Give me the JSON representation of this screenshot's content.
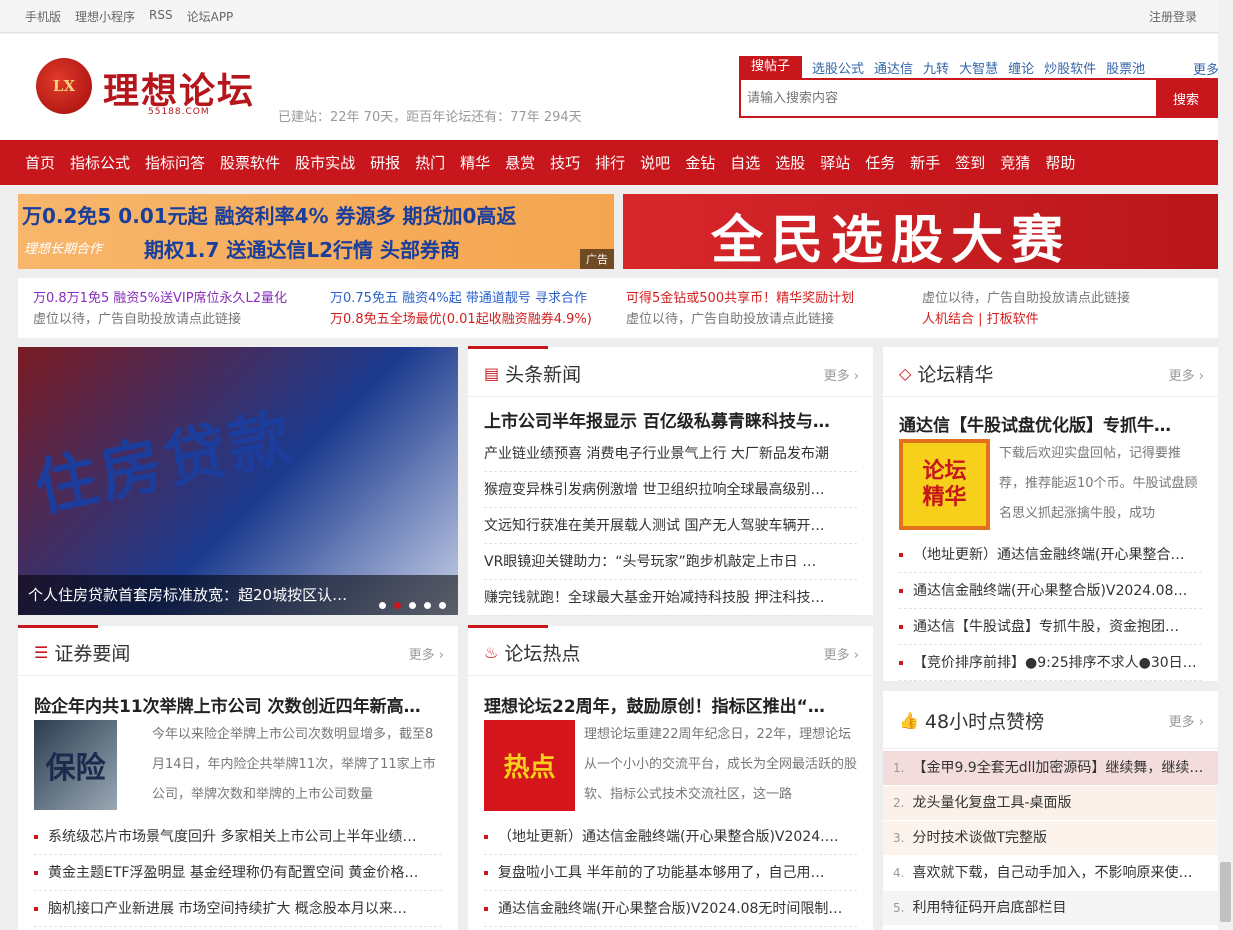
{
  "topbar": {
    "links": [
      "手机版",
      "理想小程序",
      "RSS",
      "论坛APP"
    ],
    "login": "注册登录"
  },
  "header": {
    "logo_mark": "LX",
    "logo_text": "理想论坛",
    "logo_domain": "55188.COM",
    "site_age": "已建站：22年 70天，距百年论坛还有：77年 294天"
  },
  "search": {
    "active_tab": "搜帖子",
    "tabs": [
      "选股公式",
      "通达信",
      "九转",
      "大智慧",
      "缠论",
      "炒股软件",
      "股票池"
    ],
    "more": "更多",
    "placeholder": "请输入搜索内容",
    "button": "搜索"
  },
  "nav": [
    "首页",
    "指标公式",
    "指标问答",
    "股票软件",
    "股市实战",
    "研报",
    "热门",
    "精华",
    "悬赏",
    "技巧",
    "排行",
    "说吧",
    "金钻",
    "自选",
    "选股",
    "驿站",
    "任务",
    "新手",
    "签到",
    "竞猜",
    "帮助"
  ],
  "ads": {
    "left_line1": "万0.2免5  0.01元起   融资利率4%   券源多   期货加0高返",
    "left_line2": "理想长期合作",
    "left_line3": "期权1.7    送通达信L2行情      头部券商",
    "left_tag": "广告",
    "right_text": "全民选股大赛"
  },
  "text_ads": [
    {
      "l1": "万0.8万1免5 融资5%送VIP席位永久L2量化",
      "l2": "虚位以待，广告自助投放请点此链接"
    },
    {
      "l1": "万0.75免五 融资4%起 带通道靓号 寻求合作",
      "l2": "万0.8免五全场最优(0.01起收融资融券4.9%)"
    },
    {
      "l1": "可得5金钻或500共享币！精华奖励计划",
      "l2": "虚位以待，广告自助投放请点此链接"
    },
    {
      "l1": "虚位以待，广告自助投放请点此链接",
      "l2": "人机结合 | 打板软件"
    }
  ],
  "slider": {
    "image_text": "住房贷款",
    "caption": "个人住房贷款首套房标准放宽：超20城按区认…"
  },
  "headlines": {
    "title": "头条新闻",
    "more": "更多",
    "lead": "上市公司半年报显示 百亿级私募青睐科技与…",
    "items": [
      "产业链业绩预喜 消费电子行业景气上行 大厂新品发布潮",
      "猴痘变异株引发病例激增 世卫组织拉响全球最高级别…",
      "文远知行获准在美开展载人测试 国产无人驾驶车辆开…",
      "VR眼镜迎关键助力：“头号玩家”跑步机敲定上市日 …",
      "赚完钱就跑！全球最大基金开始减持科技股 押注科技…"
    ]
  },
  "essence": {
    "title": "论坛精华",
    "more": "更多",
    "lead": "通达信【牛股试盘优化版】专抓牛…",
    "thumb_text": "论坛精华",
    "desc": "下载后欢迎实盘回帖，记得要推荐，推荐能返10个币。牛股试盘顾名思义抓起涨擒牛股，成功",
    "items": [
      "（地址更新）通达信金融终端(开心果整合…",
      "通达信金融终端(开心果整合版)V2024.08…",
      "通达信【牛股试盘】专抓牛股，资金抱团…",
      "【竞价排序前排】●9:25排序不求人●30日…"
    ]
  },
  "securities": {
    "title": "证券要闻",
    "more": "更多",
    "lead": "险企年内共11次举牌上市公司 次数创近四年新高…",
    "thumb_text": "保险",
    "desc": "今年以来险企举牌上市公司次数明显增多，截至8月14日，年内险企共举牌11次，举牌了11家上市公司，举牌次数和举牌的上市公司数量",
    "items": [
      "系统级芯片市场景气度回升 多家相关上市公司上半年业绩…",
      "黄金主题ETF浮盈明显 基金经理称仍有配置空间 黄金价格…",
      "脑机接口产业新进展 市场空间持续扩大 概念股本月以来…"
    ]
  },
  "hot": {
    "title": "论坛热点",
    "more": "更多",
    "lead": "理想论坛22周年，鼓励原创！指标区推出“…",
    "thumb_text": "热点",
    "desc": "理想论坛重建22周年纪念日，22年，理想论坛从一个小小的交流平台，成长为全网最活跃的股软、指标公式技术交流社区，这一路",
    "items": [
      "（地址更新）通达信金融终端(开心果整合版)V2024.…",
      "复盘啦小工具 半年前的了功能基本够用了，自己用…",
      "通达信金融终端(开心果整合版)V2024.08无时间限制…"
    ]
  },
  "ranking": {
    "title": "48小时点赞榜",
    "more": "更多",
    "items": [
      {
        "n": "1.",
        "t": "【金甲9.9全套无dll加密源码】继续舞，继续…"
      },
      {
        "n": "2.",
        "t": "龙头量化复盘工具-桌面版"
      },
      {
        "n": "3.",
        "t": "分时技术谈做T完整版"
      },
      {
        "n": "4.",
        "t": "喜欢就下载，自己动手加入，不影响原来使…"
      },
      {
        "n": "5.",
        "t": "利用特征码开启底部栏目"
      }
    ]
  },
  "colors": {
    "brand": "#c8161d",
    "link": "#2a62c9"
  }
}
